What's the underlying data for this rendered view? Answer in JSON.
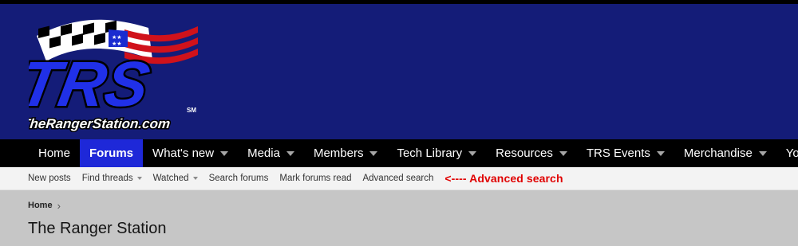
{
  "brand": {
    "logo_main": "TRS",
    "logo_site": "TheRangerStation.com",
    "logo_mark": "SM"
  },
  "nav": {
    "items": [
      {
        "label": "Home",
        "dropdown": false,
        "active": false
      },
      {
        "label": "Forums",
        "dropdown": false,
        "active": true
      },
      {
        "label": "What's new",
        "dropdown": true,
        "active": false
      },
      {
        "label": "Media",
        "dropdown": true,
        "active": false
      },
      {
        "label": "Members",
        "dropdown": true,
        "active": false
      },
      {
        "label": "Tech Library",
        "dropdown": true,
        "active": false
      },
      {
        "label": "Resources",
        "dropdown": true,
        "active": false
      },
      {
        "label": "TRS Events",
        "dropdown": true,
        "active": false
      },
      {
        "label": "Merchandise",
        "dropdown": true,
        "active": false
      },
      {
        "label": "YouTube",
        "dropdown": false,
        "active": false
      }
    ]
  },
  "subnav": {
    "items": [
      {
        "label": "New posts",
        "dropdown": false
      },
      {
        "label": "Find threads",
        "dropdown": true
      },
      {
        "label": "Watched",
        "dropdown": true
      },
      {
        "label": "Search forums",
        "dropdown": false
      },
      {
        "label": "Mark forums read",
        "dropdown": false
      },
      {
        "label": "Advanced search",
        "dropdown": false
      }
    ],
    "annotation": "<---- Advanced search"
  },
  "breadcrumb": {
    "home": "Home"
  },
  "page": {
    "title": "The Ranger Station"
  },
  "colors": {
    "header_bg": "#141c78",
    "nav_bg": "#000000",
    "nav_active": "#1e28d8",
    "annotation": "#e00000",
    "logo_blue": "#2030e8"
  },
  "icons": {
    "nav_caret": "chevron-down-icon",
    "breadcrumb_sep": "chevron-right-icon"
  }
}
